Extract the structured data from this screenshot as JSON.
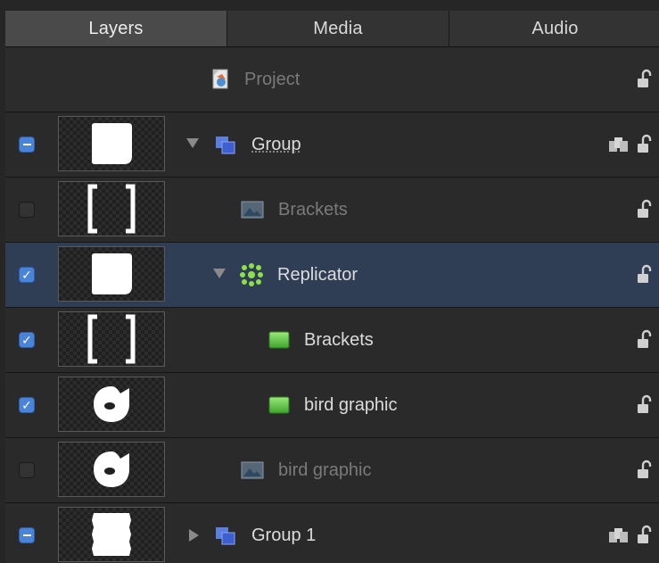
{
  "tabs": [
    {
      "label": "Layers",
      "active": true
    },
    {
      "label": "Media",
      "active": false
    },
    {
      "label": "Audio",
      "active": false
    }
  ],
  "rows": [
    {
      "label": "Project",
      "type": "project",
      "icon": "project-icon",
      "dimmed": true
    },
    {
      "label": "Group",
      "type": "group",
      "checkbox": "mixed",
      "expanded": true,
      "icon": "group-icon"
    },
    {
      "label": "Brackets",
      "type": "image",
      "checkbox": "unchecked",
      "icon": "image-icon",
      "dimmed": true
    },
    {
      "label": "Replicator",
      "type": "replicator",
      "checkbox": "checked",
      "expanded": true,
      "icon": "replicator-icon",
      "selected": true
    },
    {
      "label": "Brackets",
      "type": "cell",
      "checkbox": "checked",
      "icon": "cell-icon"
    },
    {
      "label": "bird graphic",
      "type": "cell",
      "checkbox": "checked",
      "icon": "cell-icon"
    },
    {
      "label": "bird graphic",
      "type": "image",
      "checkbox": "unchecked",
      "icon": "image-icon",
      "dimmed": true
    },
    {
      "label": "Group 1",
      "type": "group",
      "checkbox": "mixed",
      "expanded": false,
      "icon": "group-icon"
    }
  ],
  "colors": {
    "selected_row": "#2f3e54",
    "checkbox_on": "#4a84d8",
    "cell_green": "#5cc24a"
  }
}
